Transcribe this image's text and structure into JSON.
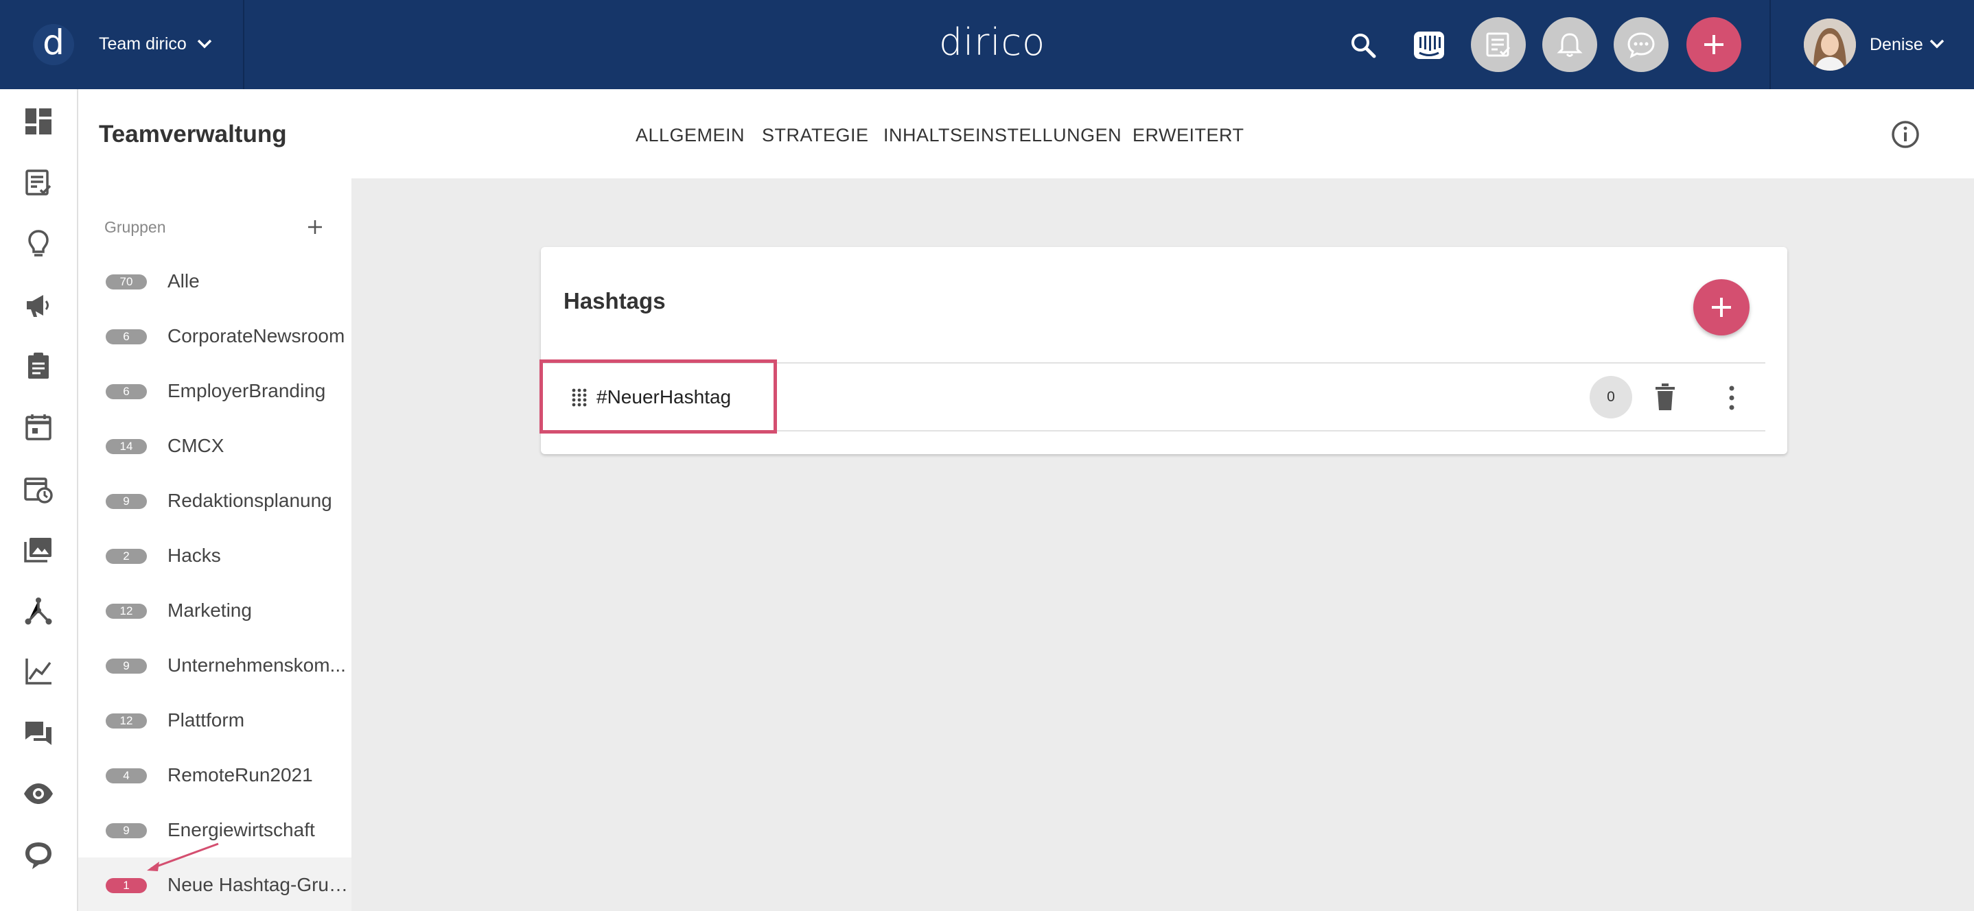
{
  "topbar": {
    "logo_letter": "d",
    "team_name": "Team dirico",
    "brand": "dirico",
    "user_name": "Denise"
  },
  "header": {
    "title": "Teamverwaltung",
    "tabs": [
      {
        "label": "ALLGEMEIN"
      },
      {
        "label": "STRATEGIE"
      },
      {
        "label": "INHALTSEINSTELLUNGEN"
      },
      {
        "label": "ERWEITERT"
      }
    ]
  },
  "groups": {
    "label": "Gruppen",
    "items": [
      {
        "count": "70",
        "name": "Alle"
      },
      {
        "count": "6",
        "name": "CorporateNewsroom"
      },
      {
        "count": "6",
        "name": "EmployerBranding"
      },
      {
        "count": "14",
        "name": "CMCX"
      },
      {
        "count": "9",
        "name": "Redaktionsplanung"
      },
      {
        "count": "2",
        "name": "Hacks"
      },
      {
        "count": "12",
        "name": "Marketing"
      },
      {
        "count": "9",
        "name": "Unternehmenskom..."
      },
      {
        "count": "12",
        "name": "Plattform"
      },
      {
        "count": "4",
        "name": "RemoteRun2021"
      },
      {
        "count": "9",
        "name": "Energiewirtschaft"
      },
      {
        "count": "1",
        "name": "Neue Hashtag-Grup..."
      }
    ]
  },
  "card": {
    "title": "Hashtags",
    "hashtags": [
      {
        "name": "#NeuerHashtag",
        "count": "0"
      }
    ]
  },
  "colors": {
    "topbar": "#163669",
    "accent": "#d44f70",
    "badge": "#9b9b9b"
  }
}
